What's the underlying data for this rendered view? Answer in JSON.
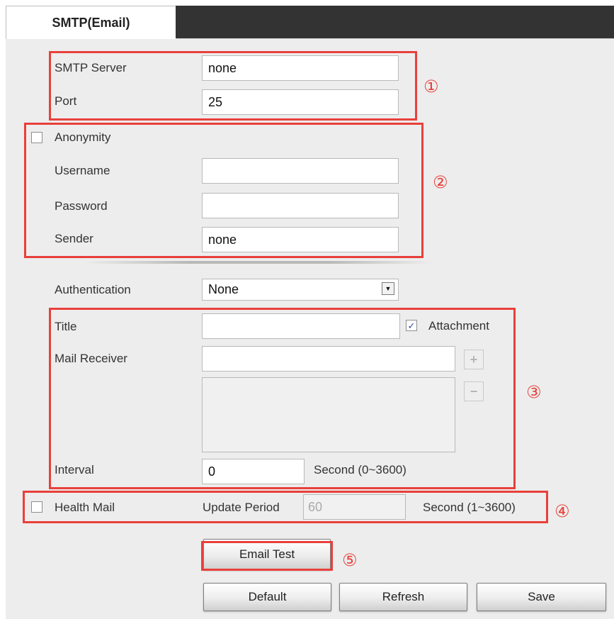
{
  "tab": {
    "label": "SMTP(Email)"
  },
  "smtp_server": {
    "label": "SMTP Server",
    "value": "none"
  },
  "port": {
    "label": "Port",
    "value": "25"
  },
  "anonymity": {
    "label": "Anonymity",
    "checked": false
  },
  "username": {
    "label": "Username",
    "value": ""
  },
  "password": {
    "label": "Password",
    "value": ""
  },
  "sender": {
    "label": "Sender",
    "value": "none"
  },
  "authentication": {
    "label": "Authentication",
    "selected": "None"
  },
  "title": {
    "label": "Title",
    "value": ""
  },
  "attachment": {
    "label": "Attachment",
    "checked": true,
    "mark": "✓"
  },
  "mail_receiver": {
    "label": "Mail Receiver",
    "value": "",
    "add_symbol": "+",
    "remove_symbol": "−"
  },
  "interval": {
    "label": "Interval",
    "value": "0",
    "unit": "Second (0~3600)"
  },
  "health_mail": {
    "label": "Health Mail",
    "checked": false,
    "update_period_label": "Update Period",
    "update_period_value": "60",
    "unit": "Second (1~3600)"
  },
  "buttons": {
    "email_test": "Email Test",
    "default": "Default",
    "refresh": "Refresh",
    "save": "Save"
  },
  "annotations": [
    "①",
    "②",
    "③",
    "④",
    "⑤"
  ],
  "colors": {
    "highlight": "#e8403b",
    "header": "#333333",
    "panel": "#ededed"
  }
}
